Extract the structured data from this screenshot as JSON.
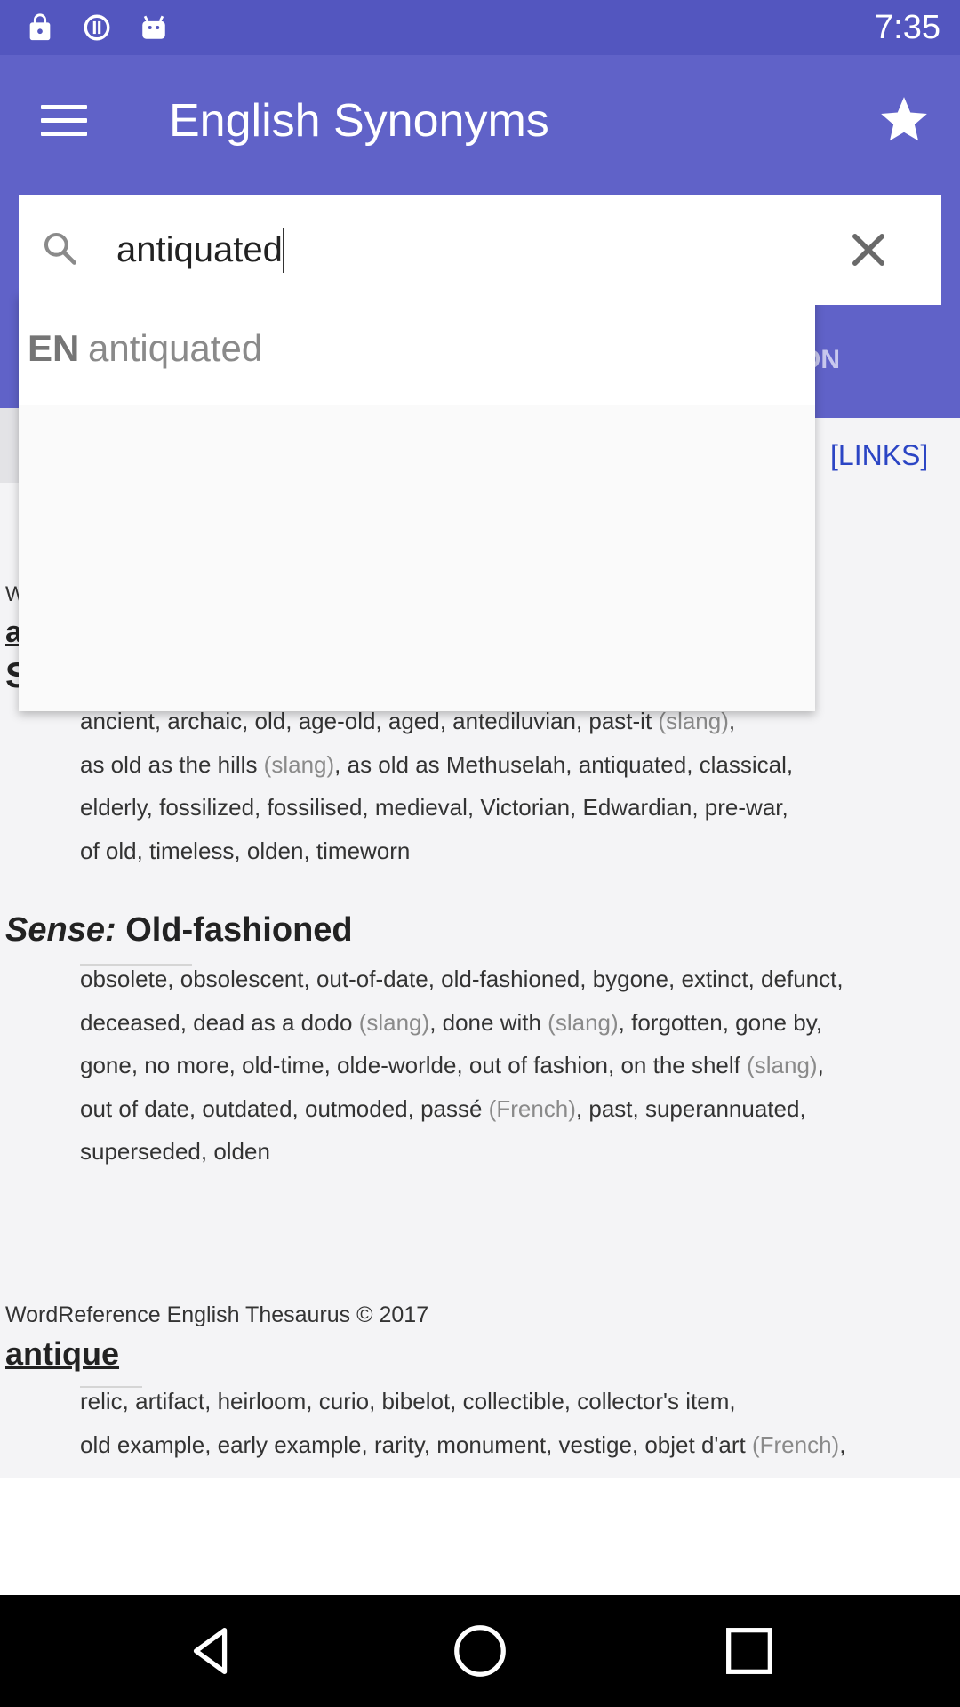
{
  "status_bar": {
    "time": "7:35",
    "icons": [
      "lock-icon",
      "data-saver-icon",
      "android-icon"
    ]
  },
  "app_bar": {
    "title": "English Synonyms",
    "menu_icon": "hamburger-menu-icon",
    "star_icon": "star-icon",
    "tab_label": "ON"
  },
  "search": {
    "value": "antiquated",
    "icon": "search-icon",
    "clear_icon": "close-icon"
  },
  "suggestion": {
    "lang": "EN",
    "word": "antiquated"
  },
  "content": {
    "links": "[LINKS]",
    "partial_w": "W",
    "partial_a": "a",
    "partial_s": "S",
    "block1": [
      {
        "parts": [
          {
            "t": "ancient, archaic, old, age-old, aged, antediluvian, past-it "
          },
          {
            "t": "(slang)",
            "g": true
          },
          {
            "t": ","
          }
        ]
      },
      {
        "parts": [
          {
            "t": "as old as the hills "
          },
          {
            "t": "(slang)",
            "g": true
          },
          {
            "t": ", as old as Methuselah, antiquated, classical,"
          }
        ]
      },
      {
        "parts": [
          {
            "t": "elderly, fossilized, fossilised, medieval, Victorian, Edwardian, pre-war,"
          }
        ]
      },
      {
        "parts": [
          {
            "t": "of old, timeless, olden, timeworn"
          }
        ]
      }
    ],
    "sense_label": "Sense:",
    "sense_value": "Old-fashioned",
    "block2": [
      {
        "parts": [
          {
            "t": "obsolete, obsolescent, out-of-date, old-fashioned, bygone, extinct, defunct,"
          }
        ]
      },
      {
        "parts": [
          {
            "t": "deceased, dead as a dodo "
          },
          {
            "t": "(slang)",
            "g": true
          },
          {
            "t": ", done with "
          },
          {
            "t": "(slang)",
            "g": true
          },
          {
            "t": ", forgotten, gone by,"
          }
        ]
      },
      {
        "parts": [
          {
            "t": "gone, no more, old-time, olde-worlde, out of fashion, on the shelf "
          },
          {
            "t": "(slang)",
            "g": true
          },
          {
            "t": ","
          }
        ]
      },
      {
        "parts": [
          {
            "t": "out of date, outdated, outmoded, passé "
          },
          {
            "t": "(French)",
            "g": true
          },
          {
            "t": ", past, superannuated,"
          }
        ]
      },
      {
        "parts": [
          {
            "t": "superseded, olden"
          }
        ]
      }
    ],
    "credit": "WordReference English Thesaurus © 2017",
    "entry_title": "antique",
    "block3": [
      {
        "parts": [
          {
            "t": "relic, artifact, heirloom, curio, bibelot, collectible, collector's item,"
          }
        ]
      },
      {
        "parts": [
          {
            "t": "old example, early example, rarity, monument, vestige, objet d'art "
          },
          {
            "t": "(French)",
            "g": true
          },
          {
            "t": ","
          }
        ]
      }
    ]
  },
  "nav_bar": {
    "back": "back-icon",
    "home": "home-icon",
    "recents": "recents-icon"
  },
  "colors": {
    "status_bar": "#5356bf",
    "app_bar": "#6062c8",
    "link": "#2b45c4",
    "slang_gray": "#8a8a8a"
  }
}
